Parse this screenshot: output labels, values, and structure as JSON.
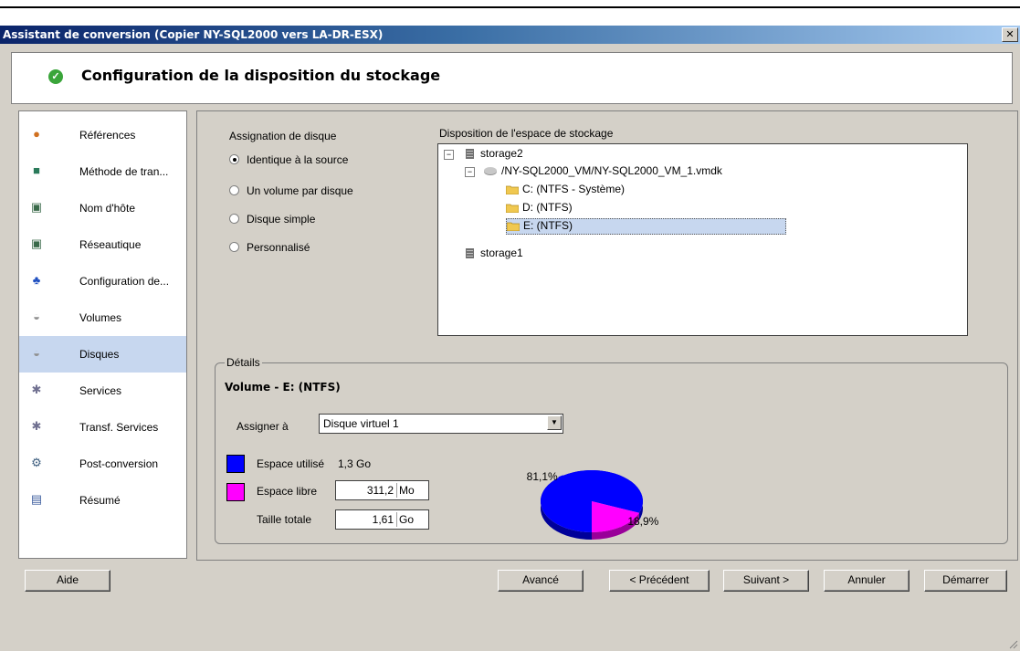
{
  "window": {
    "title": "Assistant de conversion (Copier NY-SQL2000 vers LA-DR-ESX)",
    "close": "✕"
  },
  "header": {
    "title": "Configuration de la disposition du stockage"
  },
  "sidebar": {
    "items": [
      {
        "label": "Références",
        "icon": "references-icon"
      },
      {
        "label": "Méthode de tran...",
        "icon": "transfer-method-icon"
      },
      {
        "label": "Nom d'hôte",
        "icon": "hostname-icon"
      },
      {
        "label": "Réseautique",
        "icon": "network-icon"
      },
      {
        "label": "Configuration de...",
        "icon": "config-icon"
      },
      {
        "label": "Volumes",
        "icon": "volumes-icon"
      },
      {
        "label": "Disques",
        "icon": "disks-icon",
        "selected": true
      },
      {
        "label": "Services",
        "icon": "services-icon"
      },
      {
        "label": "Transf. Services",
        "icon": "transfer-services-icon"
      },
      {
        "label": "Post-conversion",
        "icon": "post-conversion-icon"
      },
      {
        "label": "Résumé",
        "icon": "summary-icon"
      }
    ]
  },
  "assignment": {
    "title": "Assignation de disque",
    "options": [
      "Identique à la source",
      "Un volume par disque",
      "Disque simple",
      "Personnalisé"
    ],
    "selected": 0
  },
  "storage": {
    "title": "Disposition de l'espace de stockage",
    "tree": {
      "storage2": "storage2",
      "vmdk": "/NY-SQL2000_VM/NY-SQL2000_VM_1.vmdk",
      "c": "C: (NTFS - Système)",
      "d": "D: (NTFS)",
      "e": "E: (NTFS)",
      "storage1": "storage1"
    }
  },
  "details": {
    "legend": "Détails",
    "volume_title": "Volume - E: (NTFS)",
    "assign_label": "Assigner à",
    "assign_value": "Disque virtuel 1",
    "used_label": "Espace utilisé",
    "used_value": "1,3 Go",
    "free_label": "Espace libre",
    "free_value": "311,2",
    "free_unit": "Mo",
    "total_label": "Taille totale",
    "total_value": "1,61",
    "total_unit": "Go",
    "colors": {
      "used": "#0000ff",
      "free": "#ff00ff"
    }
  },
  "chart_data": {
    "type": "pie",
    "slices": [
      {
        "label": "81,1%",
        "value": 81.1,
        "color": "#0000ff"
      },
      {
        "label": "18,9%",
        "value": 18.9,
        "color": "#ff00ff"
      }
    ]
  },
  "buttons": {
    "help": "Aide",
    "advanced": "Avancé",
    "previous": "< Précédent",
    "next": "Suivant >",
    "cancel": "Annuler",
    "start": "Démarrer"
  }
}
